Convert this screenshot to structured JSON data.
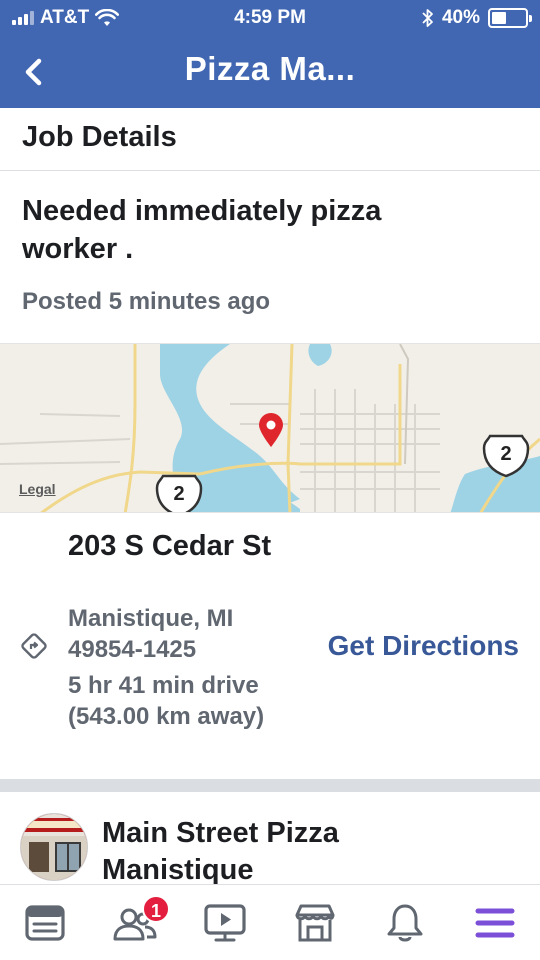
{
  "status_bar": {
    "carrier": "AT&T",
    "time": "4:59 PM",
    "battery": "40%",
    "battery_level": 0.4
  },
  "nav": {
    "title": "Pizza Ma..."
  },
  "job": {
    "section_title": "Job Details",
    "title": "Needed immediately pizza worker .",
    "posted_label": "Posted",
    "posted_time": "5 minutes ago"
  },
  "map": {
    "legal": "Legal",
    "route_shield_1": "2",
    "route_shield_2": "2",
    "pin_color": "#e0262d"
  },
  "location": {
    "street": "203 S Cedar St",
    "city": "Manistique, MI 49854-1425",
    "drive": "5 hr 41 min drive (543.00 km away)",
    "directions_label": "Get Directions"
  },
  "page": {
    "name": "Main Street Pizza Manistique"
  },
  "tabbar": {
    "items": [
      {
        "icon": "news-feed-icon"
      },
      {
        "icon": "friends-icon",
        "badge": "1"
      },
      {
        "icon": "watch-icon"
      },
      {
        "icon": "marketplace-icon"
      },
      {
        "icon": "notifications-icon"
      },
      {
        "icon": "menu-icon",
        "active": true
      }
    ]
  },
  "colors": {
    "header": "#4267b2",
    "link": "#385898",
    "badge": "#e41e3f",
    "active_tab": "#7b4fd8"
  }
}
